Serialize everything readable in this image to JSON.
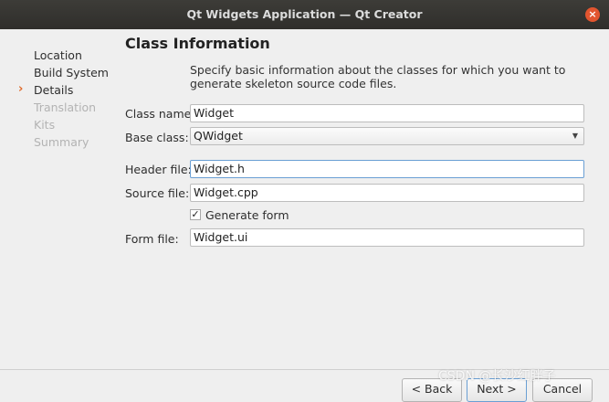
{
  "window": {
    "title": "Qt Widgets Application — Qt Creator",
    "close_glyph": "×"
  },
  "sidebar": {
    "items": [
      {
        "label": "Location",
        "state": "done"
      },
      {
        "label": "Build System",
        "state": "done"
      },
      {
        "label": "Details",
        "state": "current"
      },
      {
        "label": "Translation",
        "state": "disabled"
      },
      {
        "label": "Kits",
        "state": "disabled"
      },
      {
        "label": "Summary",
        "state": "disabled"
      }
    ],
    "current_marker": "›"
  },
  "page": {
    "title": "Class Information",
    "description": "Specify basic information about the classes for which you want to generate skeleton source code files."
  },
  "form": {
    "class_name": {
      "label": "Class name:",
      "value": "Widget"
    },
    "base_class": {
      "label": "Base class:",
      "value": "QWidget"
    },
    "header_file": {
      "label": "Header file:",
      "value": "Widget.h"
    },
    "source_file": {
      "label": "Source file:",
      "value": "Widget.cpp"
    },
    "generate_form": {
      "label": "Generate form",
      "checked": true,
      "check_glyph": "✓"
    },
    "form_file": {
      "label": "Form file:",
      "value": "Widget.ui"
    }
  },
  "buttons": {
    "back": "< Back",
    "next": "Next >",
    "cancel": "Cancel"
  },
  "watermark": "CSDN @长沙红胖子",
  "colors": {
    "accent": "#e06a2b",
    "focus": "#6a9fd4",
    "titlebar": "#2f2e2b"
  }
}
